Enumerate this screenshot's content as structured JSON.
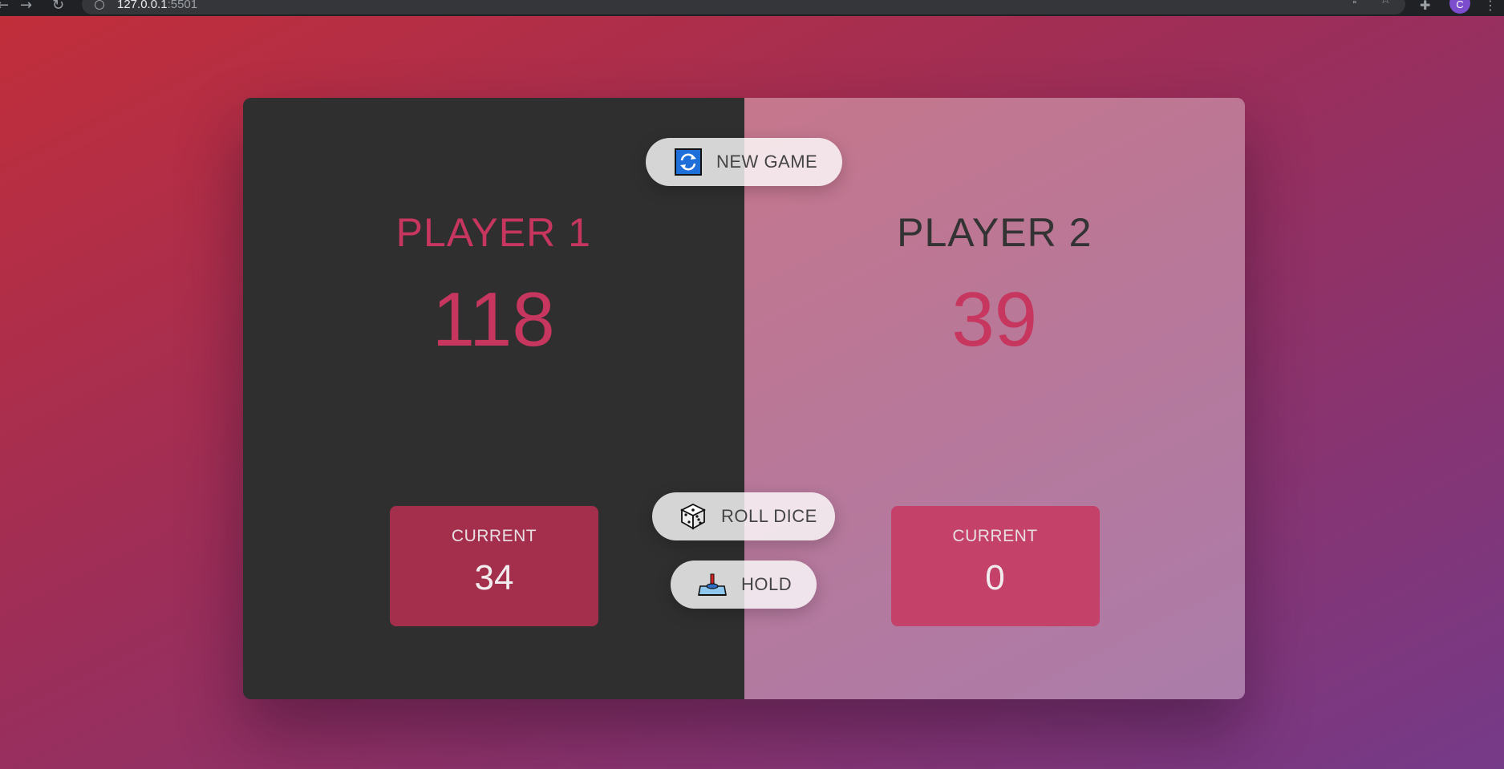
{
  "browser": {
    "url_host": "127.0.0.1",
    "url_port": ":5501",
    "profile_initial": "C",
    "icons": [
      "back-arrow-icon",
      "forward-arrow-icon",
      "reload-icon",
      "site-info-icon",
      "share-icon",
      "star-icon",
      "extensions-icon",
      "menu-icon"
    ]
  },
  "buttons": {
    "new_game": {
      "label": "NEW GAME",
      "icon": "refresh-icon"
    },
    "roll_dice": {
      "label": "ROLL DICE",
      "icon": "dice-icon"
    },
    "hold": {
      "label": "HOLD",
      "icon": "hold-joystick-icon"
    }
  },
  "players": [
    {
      "name": "PLAYER 1",
      "score": "118",
      "current_label": "CURRENT",
      "current_score": "34",
      "active": true
    },
    {
      "name": "PLAYER 2",
      "score": "39",
      "current_label": "CURRENT",
      "current_score": "0",
      "active": false
    }
  ],
  "colors": {
    "accent": "#c7365f",
    "active_panel": "#2f2f2f",
    "current_box_active": "#a42f4d",
    "current_box_inactive": "#c4426a",
    "background_start": "#c12e3a",
    "background_end": "#753a88"
  }
}
